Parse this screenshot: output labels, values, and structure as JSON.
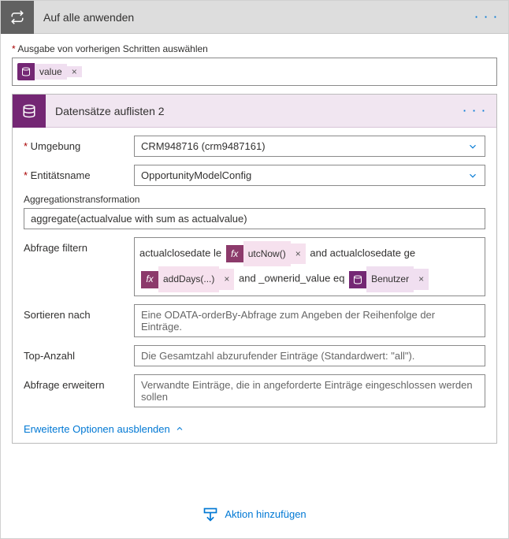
{
  "header": {
    "title": "Auf alle anwenden",
    "menu": "· · ·"
  },
  "prev_output_label": "Ausgabe von vorherigen Schritten auswählen",
  "value_token": "value",
  "sub_header": {
    "title": "Datensätze auflisten 2",
    "menu": "· · ·"
  },
  "fields": {
    "umgebung_label": "Umgebung",
    "umgebung_value": "CRM948716 (crm9487161)",
    "entitaet_label": "Entitätsname",
    "entitaet_value": "OpportunityModelConfig",
    "aggr_label": "Aggregationstransformation",
    "aggr_value": "aggregate(actualvalue with sum as actualvalue)",
    "filter_label": "Abfrage filtern",
    "filter": {
      "t1": "actualclosedate le",
      "fx_utcnow": "utcNow()",
      "t2": "and actualclosedate ge",
      "fx_adddays": "addDays(...)",
      "t3": "and _ownerid_value eq",
      "benutzer": "Benutzer"
    },
    "sort_label": "Sortieren nach",
    "sort_ph": "Eine ODATA-orderBy-Abfrage zum Angeben der Reihenfolge der Einträge.",
    "top_label": "Top-Anzahl",
    "top_ph": "Die Gesamtzahl abzurufender Einträge (Standardwert: \"all\").",
    "expand_label": "Abfrage erweitern",
    "expand_ph": "Verwandte Einträge, die in angeforderte Einträge eingeschlossen werden sollen"
  },
  "hide_options": "Erweiterte Optionen ausblenden",
  "add_action": "Aktion hinzufügen"
}
